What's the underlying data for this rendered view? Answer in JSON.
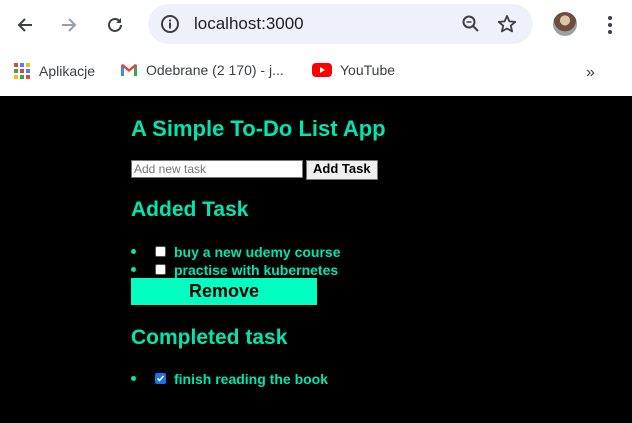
{
  "browser": {
    "url": "localhost:3000",
    "bookmarks": [
      {
        "label": "Aplikacje"
      },
      {
        "label": "Odebrane (2 170) - j..."
      },
      {
        "label": "YouTube"
      }
    ],
    "more": "»"
  },
  "app": {
    "title": "A Simple To-Do List App",
    "input_placeholder": "Add new task",
    "add_button": "Add Task",
    "added_heading": "Added Task",
    "added_tasks": [
      {
        "label": "buy a new udemy course",
        "checked": false
      },
      {
        "label": "practise with kubernetes",
        "checked": false
      }
    ],
    "remove_button": "Remove",
    "completed_heading": "Completed task",
    "completed_tasks": [
      {
        "label": "finish reading the book",
        "checked": true
      }
    ]
  },
  "colors": {
    "accent": "#00ffc0",
    "background": "#000000"
  }
}
